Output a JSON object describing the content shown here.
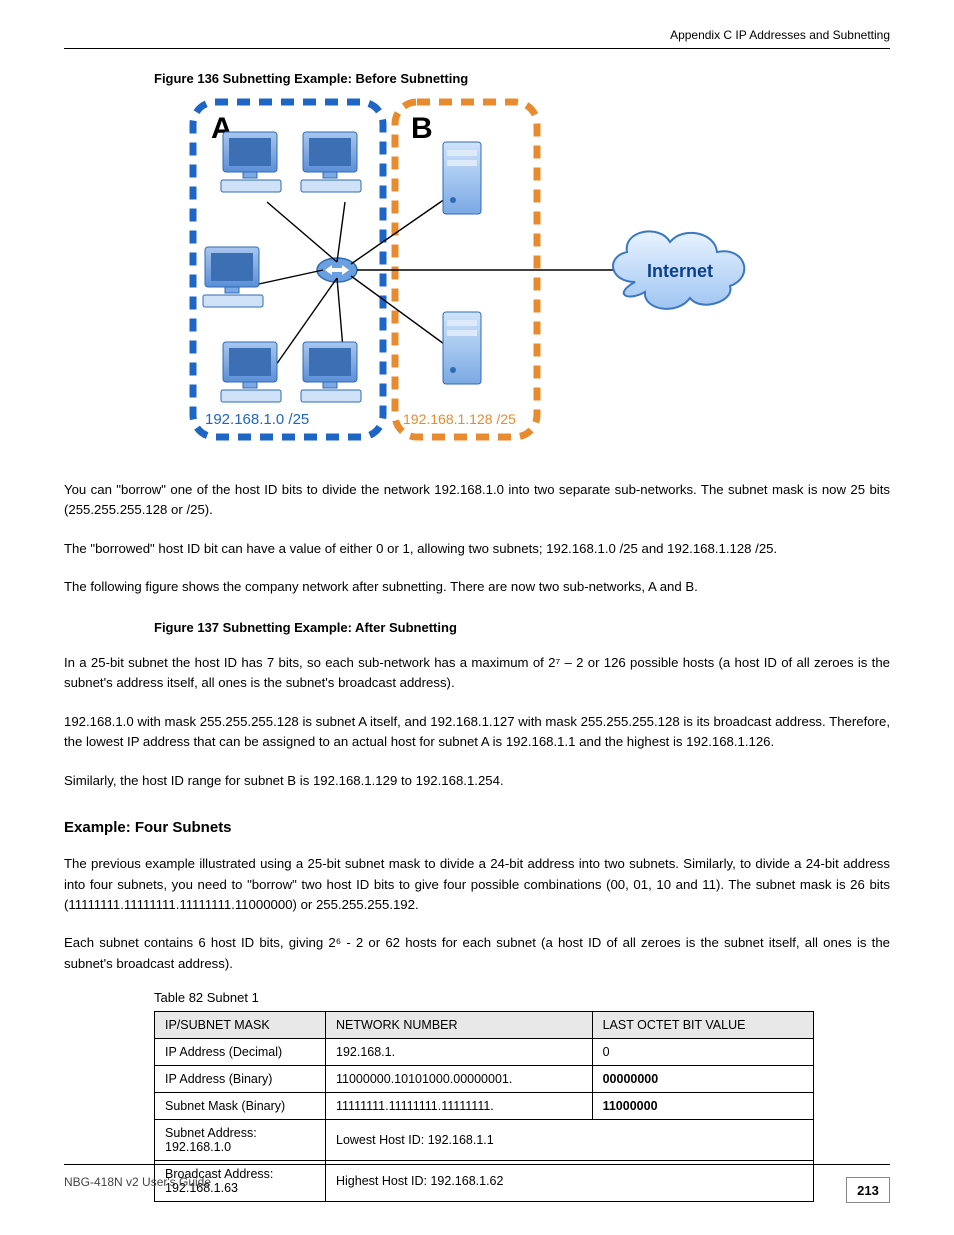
{
  "header": "Appendix C IP Addresses and Subnetting",
  "figure_caption": "Figure 136   Subnetting Example: Before Subnetting",
  "diagram": {
    "group_a": "A",
    "group_b": "B",
    "cidr_a": "192.168.1.0 /25",
    "cidr_b": "192.168.1.128 /25",
    "internet": "Internet"
  },
  "para1": "You can \"borrow\" one of the host ID bits to divide the network 192.168.1.0 into two separate sub-networks. The subnet mask is now 25 bits (255.255.255.128 or /25).",
  "para2": "The \"borrowed\" host ID bit can have a value of either 0 or 1, allowing two subnets; 192.168.1.0 /25 and 192.168.1.128 /25.",
  "para3": "The following figure shows the company network after subnetting. There are now two sub-networks, A and B.",
  "figure_caption2": "Figure 137   Subnetting Example: After Subnetting",
  "para4": "In a 25-bit subnet the host ID has 7 bits, so each sub-network has a maximum of 2⁷ – 2 or 126 possible hosts (a host ID of all zeroes is the subnet's address itself, all ones is the subnet's broadcast address).",
  "para5": "192.168.1.0 with mask 255.255.255.128 is subnet A itself, and 192.168.1.127 with mask 255.255.255.128 is its broadcast address. Therefore, the lowest IP address that can be assigned to an actual host for subnet A is 192.168.1.1 and the highest is 192.168.1.126.",
  "para6": "Similarly, the host ID range for subnet B is 192.168.1.129 to 192.168.1.254.",
  "section_head": "Example: Four Subnets",
  "para7": "The previous example illustrated using a 25-bit subnet mask to divide a 24-bit address into two subnets. Similarly, to divide a 24-bit address into four subnets, you need to \"borrow\" two host ID bits to give four possible combinations (00, 01, 10 and 11). The subnet mask is 26 bits (11111111.11111111.11111111.11000000) or 255.255.255.192.",
  "para8": "Each subnet contains 6 host ID bits, giving 2⁶ - 2 or 62 hosts for each subnet (a host ID of all zeroes is the subnet itself, all ones is the subnet's broadcast address).",
  "table_caption": "Table 82   Subnet 1",
  "table": {
    "head_left": "IP/SUBNET MASK",
    "head_mid": "NETWORK NUMBER",
    "head_right": "LAST OCTET BIT VALUE",
    "rows": [
      {
        "label": "IP Address (Decimal)",
        "mid": "192.168.1.",
        "right": "0"
      },
      {
        "label": "IP Address (Binary)",
        "mid": "11000000.10101000.00000001.",
        "right": "00000000"
      },
      {
        "label": "Subnet Mask (Binary)",
        "mid": "11111111.11111111.11111111.",
        "right": "11000000"
      },
      {
        "label": "Subnet Address: 192.168.1.0",
        "span": "Lowest Host ID: 192.168.1.1"
      },
      {
        "label": "Broadcast Address: 192.168.1.63",
        "span": "Highest Host ID: 192.168.1.62"
      }
    ]
  },
  "footer_left": "NBG-418N v2 User's Guide",
  "page_number": "213"
}
